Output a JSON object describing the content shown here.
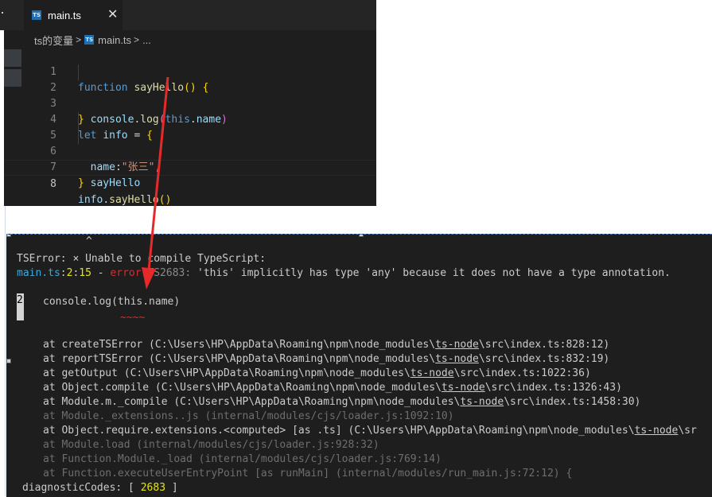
{
  "editor": {
    "tab": {
      "label": "main.ts",
      "icon": "ts-file-icon",
      "close_symbol": "✕"
    },
    "breadcrumb": {
      "folder": "ts的变量",
      "file": "main.ts",
      "more": "..."
    },
    "badge_text": "TS",
    "lines": [
      {
        "num": "1"
      },
      {
        "num": "2"
      },
      {
        "num": "3"
      },
      {
        "num": "4"
      },
      {
        "num": "5"
      },
      {
        "num": "6"
      },
      {
        "num": "7"
      },
      {
        "num": "8"
      }
    ],
    "tokens": {
      "l1_kw": "function",
      "l1_fn": "sayHello",
      "l1_paren": "()",
      "l1_brace": "{",
      "l2_obj": "console",
      "l2_dot": ".",
      "l2_fn": "log",
      "l2_open": "(",
      "l2_this": "this",
      "l2_dot2": ".",
      "l2_prop": "name",
      "l2_close": ")",
      "l3_brace": "}",
      "l4_kw": "let",
      "l4_var": "info",
      "l4_eq": "=",
      "l4_brace": "{",
      "l5_key": "name",
      "l5_colon": ":",
      "l5_str": "\"张三\"",
      "l5_comma": ",",
      "l6_val": "sayHello",
      "l7_brace": "}",
      "l8_var": "info",
      "l8_dot": ".",
      "l8_fn": "sayHello",
      "l8_paren": "()"
    }
  },
  "terminal": {
    "caret": "^",
    "ts_error_label": "TSError:",
    "ts_error_message": "× Unable to compile TypeScript:",
    "err_location": {
      "file": "main.ts",
      "colon1": ":",
      "line": "2",
      "colon2": ":",
      "col": "15",
      "dash": " - ",
      "level": "error",
      "code": " TS2683: ",
      "message": "'this' implicitly has type 'any' because it does not have a type annotation."
    },
    "snippet": {
      "line_number": "2",
      "code": "console.log(this.name)",
      "squiggle": "~~~~"
    },
    "stack": [
      {
        "pre": "at createTSError (C:\\Users\\HP\\AppData\\Roaming\\npm\\node_modules\\",
        "ul": "ts-node",
        "post": "\\src\\index.ts:828:12)",
        "dim": false
      },
      {
        "pre": "at reportTSError (C:\\Users\\HP\\AppData\\Roaming\\npm\\node_modules\\",
        "ul": "ts-node",
        "post": "\\src\\index.ts:832:19)",
        "dim": false
      },
      {
        "pre": "at getOutput (C:\\Users\\HP\\AppData\\Roaming\\npm\\node_modules\\",
        "ul": "ts-node",
        "post": "\\src\\index.ts:1022:36)",
        "dim": false
      },
      {
        "pre": "at Object.compile (C:\\Users\\HP\\AppData\\Roaming\\npm\\node_modules\\",
        "ul": "ts-node",
        "post": "\\src\\index.ts:1326:43)",
        "dim": false
      },
      {
        "pre": "at Module.m._compile (C:\\Users\\HP\\AppData\\Roaming\\npm\\node_modules\\",
        "ul": "ts-node",
        "post": "\\src\\index.ts:1458:30)",
        "dim": false
      },
      {
        "pre": "at Module._extensions..js (internal/modules/cjs/loader.js:1092:10)",
        "ul": "",
        "post": "",
        "dim": true
      },
      {
        "pre": "at Object.require.extensions.<computed> [as .ts] (C:\\Users\\HP\\AppData\\Roaming\\npm\\node_modules\\",
        "ul": "ts-node",
        "post": "\\sr",
        "dim": false
      },
      {
        "pre": "at Module.load (internal/modules/cjs/loader.js:928:32)",
        "ul": "",
        "post": "",
        "dim": true
      },
      {
        "pre": "at Function.Module._load (internal/modules/cjs/loader.js:769:14)",
        "ul": "",
        "post": "",
        "dim": true
      },
      {
        "pre": "at Function.executeUserEntryPoint [as runMain] (internal/modules/run_main.js:72:12)",
        "ul": "",
        "post": " {",
        "dim": true
      }
    ],
    "diagnostic": {
      "label": "diagnosticCodes: [ ",
      "value": "2683",
      "close": " ]"
    }
  },
  "colors": {
    "arrow": "#e8292a",
    "editor_bg": "#1e1e1e",
    "terminal_bg": "#1e1e1e"
  }
}
